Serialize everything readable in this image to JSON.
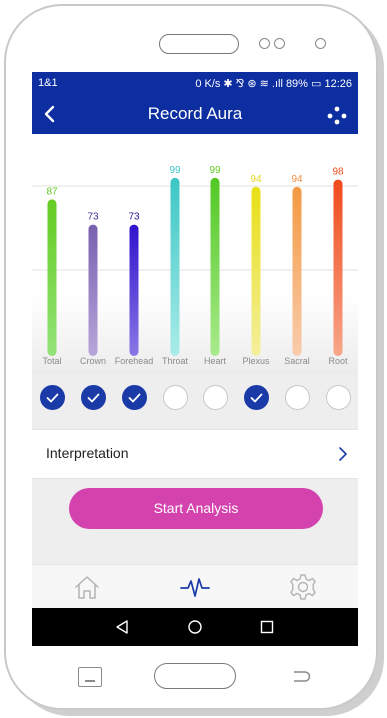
{
  "status_bar": {
    "carrier": "1&1",
    "right_text": "0 K/s ✱ ⅋ ⊛ ≋ .ıll 89% ▭ 12:26"
  },
  "app_bar": {
    "title": "Record Aura",
    "back_icon": "chevron-left-icon",
    "menu_icon": "dots-menu-icon"
  },
  "chart_data": {
    "type": "bar",
    "categories": [
      "Total",
      "Crown",
      "Forehead",
      "Throat",
      "Heart",
      "Plexus",
      "Sacral",
      "Root"
    ],
    "values": [
      87,
      73,
      73,
      99,
      99,
      94,
      94,
      98
    ],
    "value_labels": [
      "87",
      "73",
      "73",
      "99",
      "99",
      "94",
      "94",
      "98"
    ],
    "colors": {
      "top": [
        "#63cc21",
        "#7860b0",
        "#3012cc",
        "#3cc6c4",
        "#52c824",
        "#e8df16",
        "#f39a42",
        "#f04a1c"
      ],
      "bottom": [
        "#93e37a",
        "#b7a6da",
        "#8a78e6",
        "#a9ece9",
        "#a8ea8c",
        "#f4ef9c",
        "#f9ccac",
        "#f7a68a"
      ],
      "label": [
        "#63cc21",
        "#43308f",
        "#23128f",
        "#3cc6c4",
        "#63cc21",
        "#e2d81c",
        "#f08a3a",
        "#f04a1c"
      ]
    },
    "ylim": [
      0,
      100
    ],
    "grid": true
  },
  "selection": [
    true,
    true,
    true,
    false,
    false,
    true,
    false,
    false
  ],
  "interpretation": {
    "label": "Interpretation"
  },
  "start_button": {
    "label": "Start Analysis"
  },
  "colors": {
    "primary": "#0d2ea0",
    "accent": "#d342ad",
    "check_selected": "#1a3aa8"
  },
  "bottom_nav": [
    {
      "icon": "home-icon",
      "active": false
    },
    {
      "icon": "pulse-icon",
      "active": true
    },
    {
      "icon": "gear-icon",
      "active": false
    }
  ],
  "system_nav": [
    "back-triangle-icon",
    "home-circle-icon",
    "recents-square-icon"
  ]
}
